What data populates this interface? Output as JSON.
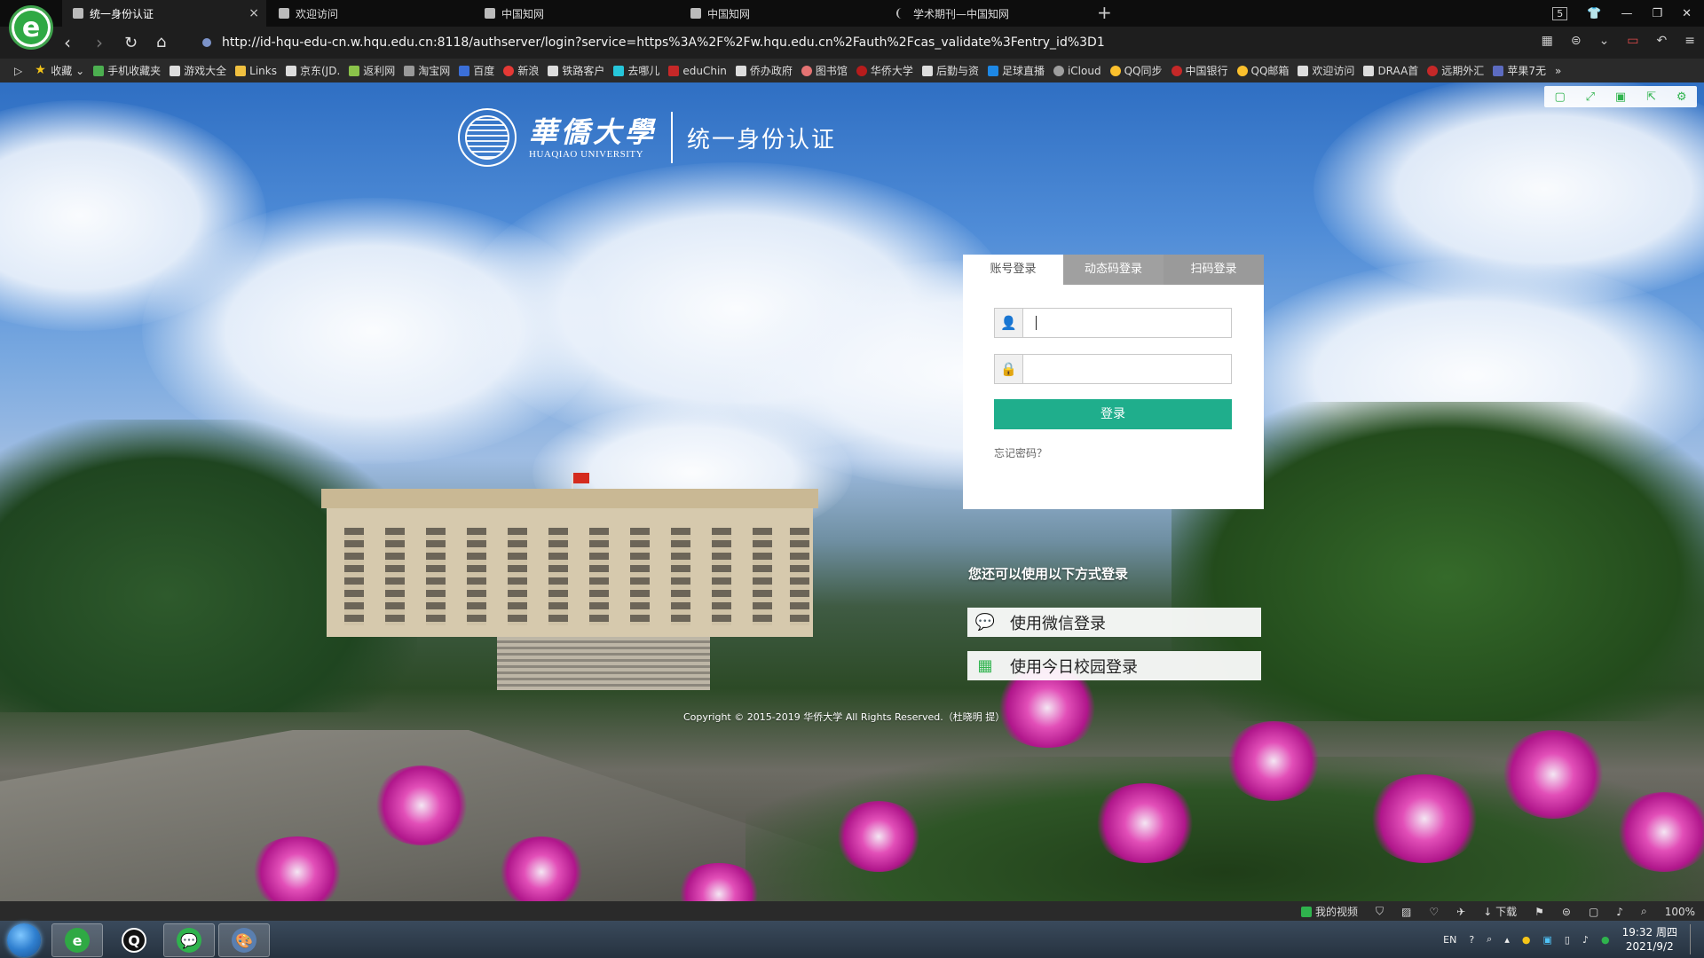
{
  "browser": {
    "tabs": [
      {
        "label": "统一身份认证",
        "active": true
      },
      {
        "label": "欢迎访问",
        "active": false
      },
      {
        "label": "中国知网",
        "active": false
      },
      {
        "label": "中国知网",
        "active": false
      },
      {
        "label": "学术期刊—中国知网",
        "active": false
      }
    ],
    "tab_close_icon": "×",
    "new_tab_icon": "+",
    "window_badge": "5",
    "url": "http://id-hqu-edu-cn.w.hqu.edu.cn:8118/authserver/login?service=https%3A%2F%2Fw.hqu.edu.cn%2Fauth%2Fcas_validate%3Fentry_id%3D1",
    "bookmarks": [
      "收藏",
      "手机收藏夹",
      "游戏大全",
      "Links",
      "京东(JD.",
      "返利网",
      "淘宝网",
      "百度",
      "新浪",
      "铁路客户",
      "去哪儿",
      "eduChin",
      "侨办政府",
      "图书馆",
      "华侨大学",
      "后勤与资",
      "足球直播",
      "iCloud",
      "QQ同步",
      "中国银行",
      "QQ邮箱",
      "欢迎访问",
      "DRAA首",
      "远期外汇",
      "苹果7无"
    ],
    "bookmark_more": "»",
    "accent": "#2fb34d"
  },
  "page": {
    "university_cn": "華僑大學",
    "university_en": "HUAQIAO UNIVERSITY",
    "site_title": "统一身份认证",
    "login": {
      "tabs": [
        "账号登录",
        "动态码登录",
        "扫码登录"
      ],
      "username_value": "",
      "password_value": "",
      "submit_label": "登录",
      "forgot_label": "忘记密码？",
      "button_color": "#1fae8c"
    },
    "alt_login_title": "您还可以使用以下方式登录",
    "alt_login": [
      {
        "label": "使用微信登录",
        "icon": "wechat-icon"
      },
      {
        "label": "使用今日校园登录",
        "icon": "qrcode-icon"
      }
    ],
    "copyright": "Copyright © 2015-2019 华侨大学 All Rights Reserved.（杜晓明 提）"
  },
  "statusbar": {
    "video": "我的视频",
    "download": "下载",
    "zoom": "100%"
  },
  "taskbar": {
    "input_lang": "EN",
    "time": "19:32 周四",
    "date": "2021/9/2"
  }
}
